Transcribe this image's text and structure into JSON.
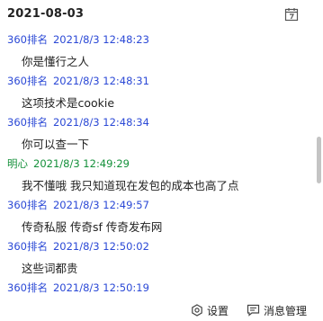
{
  "header": {
    "date": "2021-08-03"
  },
  "messages": [
    {
      "sender": "360排名",
      "time": "2021/8/3 12:48:23",
      "text": "你是懂行之人",
      "color": "#2b49d6"
    },
    {
      "sender": "360排名",
      "time": "2021/8/3 12:48:31",
      "text": "这项技术是cookie",
      "color": "#2b49d6"
    },
    {
      "sender": "360排名",
      "time": "2021/8/3 12:48:34",
      "text": "你可以查一下",
      "color": "#2b49d6"
    },
    {
      "sender": "明心",
      "time": "2021/8/3 12:49:29",
      "text": "我不懂哦 我只知道现在发包的成本也高了点",
      "color": "#14903a"
    },
    {
      "sender": "360排名",
      "time": "2021/8/3 12:49:57",
      "text": "传奇私服 传奇sf 传奇发布网",
      "color": "#2b49d6"
    },
    {
      "sender": "360排名",
      "time": "2021/8/3 12:50:02",
      "text": "这些词都贵",
      "color": "#2b49d6"
    },
    {
      "sender": "360排名",
      "time": "2021/8/3 12:50:19",
      "text": "",
      "color": "#2b49d6"
    }
  ],
  "footer": {
    "settings_label": "设置",
    "message_manager_label": "消息管理"
  },
  "icons": {
    "calendar": "calendar-icon",
    "settings": "gear-icon",
    "message_manager": "chat-icon"
  }
}
